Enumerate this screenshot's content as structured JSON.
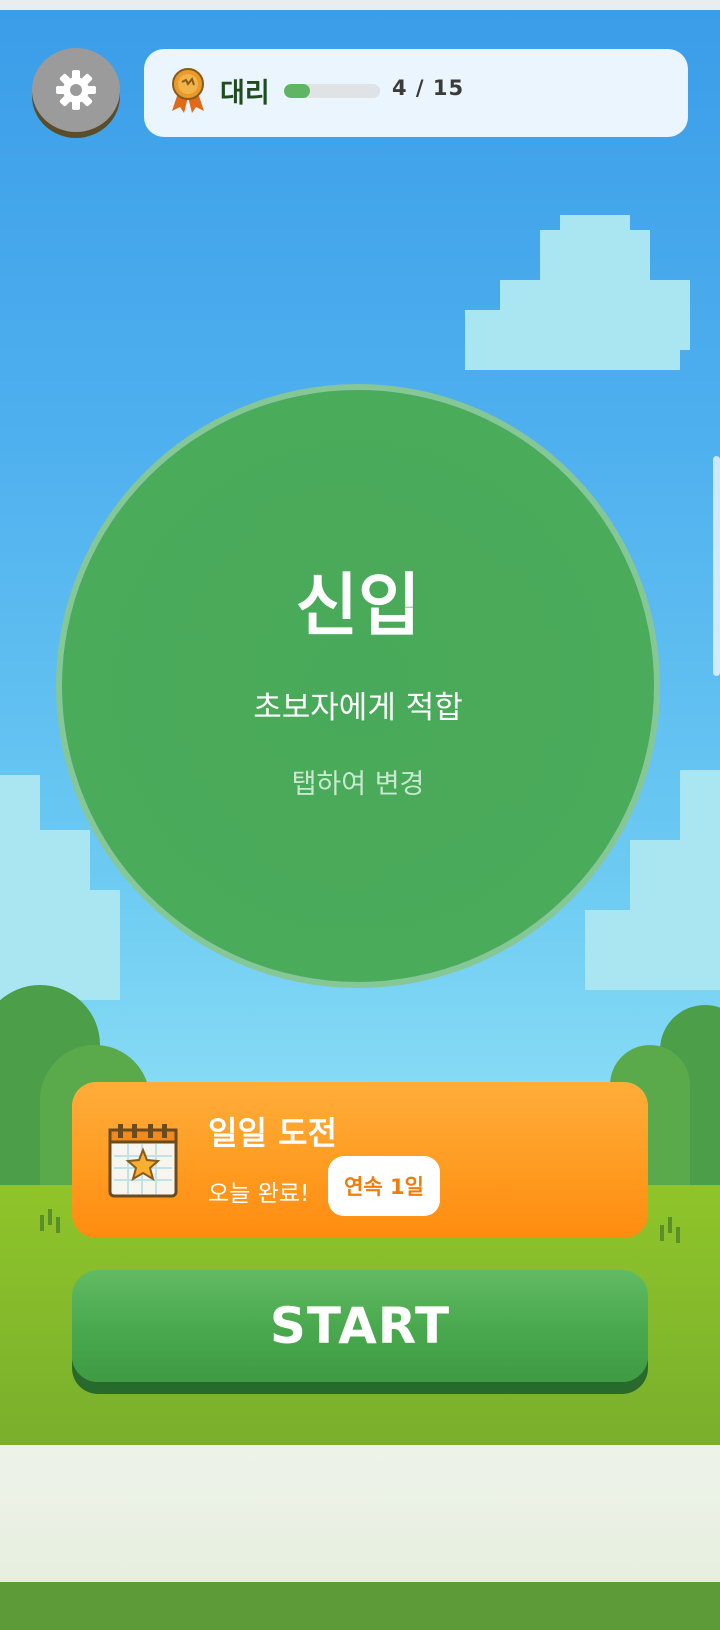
{
  "header": {
    "rank": "대리",
    "progress": {
      "current": 4,
      "total": 15,
      "text": "4 / 15"
    },
    "settings_icon": "gear-icon",
    "rank_icon": "medal-icon"
  },
  "difficulty": {
    "title": "신입",
    "subtitle": "초보자에게 적합",
    "hint": "탭하여 변경"
  },
  "daily": {
    "title": "일일 도전",
    "status": "오늘 완료!",
    "streak": "연속 1일",
    "icon": "calendar-star-icon"
  },
  "start": {
    "label": "START"
  },
  "colors": {
    "difficulty_circle": "#4aab5b",
    "daily_card": "#ff9a1f",
    "start_button": "#4aa94e",
    "progress_fill": "#5fb564"
  }
}
